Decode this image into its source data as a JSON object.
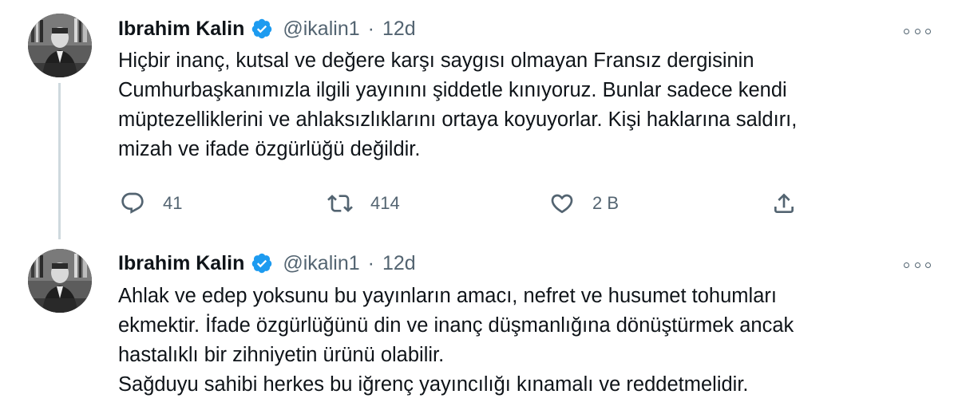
{
  "tweets": [
    {
      "author": {
        "name": "Ibrahim Kalin",
        "handle": "@ikalin1",
        "separator": "·",
        "time": "12d"
      },
      "text": "Hiçbir inanç, kutsal ve değere karşı saygısı olmayan Fransız dergisinin\nCumhurbaşkanımızla ilgili yayınını şiddetle kınıyoruz. Bunlar sadece kendi\nmüptezelliklerini ve ahlaksızlıklarını ortaya koyuyorlar. Kişi haklarına saldırı,\nmizah ve ifade özgürlüğü değildir.",
      "actions": {
        "replies": "41",
        "retweets": "414",
        "likes": "2 B"
      }
    },
    {
      "author": {
        "name": "Ibrahim Kalin",
        "handle": "@ikalin1",
        "separator": "·",
        "time": "12d"
      },
      "text": "Ahlak ve edep yoksunu bu yayınların amacı, nefret ve husumet tohumları\nekmektir. İfade özgürlüğünü din ve inanç düşmanlığına dönüştürmek ancak\nhastalıklı bir zihniyetin ürünü olabilir.\nSağduyu sahibi herkes bu iğrenç yayıncılığı kınamalı ve reddetmelidir."
    }
  ],
  "icons": {
    "verified": "verified-badge-icon",
    "more": "more-options-icon",
    "reply": "reply-icon",
    "retweet": "retweet-icon",
    "like": "heart-icon",
    "share": "share-icon"
  },
  "colors": {
    "text_primary": "#0f1419",
    "text_secondary": "#536471",
    "verified_blue": "#1d9bf0",
    "thread_line": "#cfd9de"
  }
}
